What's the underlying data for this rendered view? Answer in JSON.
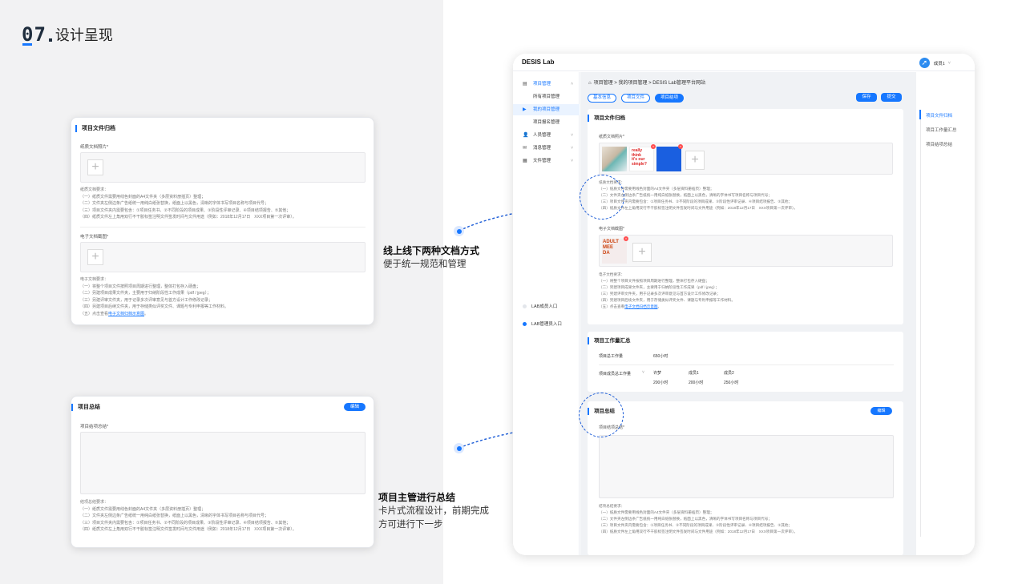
{
  "header": {
    "number": "07",
    "title": "设计呈现"
  },
  "left_card1": {
    "title": "项目文件归档",
    "paper_label": "纸质文档照片*",
    "paper_req_title": "纸质文档要求：",
    "paper_req": [
      "（一）纸质文件需要用线色封面的A4文件夹（多层资料册插页）整理；",
      "（二）文件夹左侧边条广告纸统一用纯白纸张替换，纸面上以黑色，清晰的字体书写项目名称与项目代号；",
      "（三）项目文件夹内需要包含：①项目任务书、②不同阶段的项目成果、③阶段性评审记录、④项目结项报告、⑤其他；",
      "（四）纸质文件左上角用双行不干胶标签注明文件签发时间与文件用途（例如：2018年12月17日　XXX项目第一次评审）。"
    ],
    "elec_label": "电子文档截图*",
    "elec_req_title": "电子文档要求：",
    "elec_req": [
      "（一）将整个项目文件按照项目周期进行整理，整体打包存入硬盘；",
      "（二）另建项目成果文件夹，主要用于归纳阶段性工作成果（pdf / jpeg）；",
      "（三）另建评审文件夹，用于记录多次评审意见与首方设计工作修改记录；",
      "（四）另建项目后续文件夹，用于存储类似评奖文件、课题与专利申报等工作材料。"
    ],
    "elec_req_last": "（五）点击查看",
    "elec_req_link": "电子文档归档示意图",
    "elec_req_end": "。"
  },
  "left_card2": {
    "title": "项目总结",
    "edit": "编辑",
    "summary_label": "项目结项总结*",
    "req_title": "结项总结要求：",
    "req": [
      "（一）纸质文件需要用线色封面的A4文件夹（多层资料册插页）整理；",
      "（二）文件夹左侧边条广告纸统一用纯白纸张替换，纸面上以黑色，清晰的字体书写项目名称与项目代号；",
      "（三）项目文件夹内需要包含：①项目任务书、②不同阶段的项目成果、③阶段性评审记录、④项目结项报告、⑤其他；",
      "（四）纸质文件左上角用双行不干胶标签注明文件签发时间与文件用途（例如：2018年12月17日　XXX项目第一次评审）。"
    ]
  },
  "annotations": [
    {
      "heading": "线上线下两种文档方式",
      "sub": [
        "便于统一规范和管理"
      ]
    },
    {
      "heading": "项目主管进行总结",
      "sub": [
        "卡片式流程设计，前期完成",
        "方可进行下一步"
      ]
    }
  ],
  "app": {
    "logo": "DESIS Lab",
    "user": "成员1",
    "nav": [
      {
        "label": "项目管理",
        "icon": "▤",
        "chevron": "˄"
      },
      {
        "label": "所有项目管理"
      },
      {
        "label": "我的项目管理",
        "icon": "▶"
      },
      {
        "label": "项目报名管理"
      },
      {
        "label": "人员管理",
        "icon": "👤",
        "chevron": "˅"
      },
      {
        "label": "消息管理",
        "icon": "✉",
        "chevron": "˅"
      },
      {
        "label": "文件管理",
        "icon": "▦",
        "chevron": "˅"
      }
    ],
    "entries": [
      "LAB成员入口",
      "LAB管理员入口"
    ],
    "breadcrumb": "项目管理 > 我的项目管理 > DESIS Lab管理平台网站",
    "tabs": [
      "基本信息",
      "项目文件",
      "项目结项"
    ],
    "save": "保存",
    "submit": "提交",
    "right_nav": [
      "项目文件归档",
      "项目工作量汇总",
      "项目结项总结"
    ],
    "archive": {
      "title": "项目文件归档",
      "paper_label": "纸质文档照片*",
      "thumb_text": [
        "really\nthink\nit's our\nsimple?"
      ],
      "req_title": "纸质文档要求：",
      "req": [
        "（一）纸质文件需要用线色封面的A4文件夹（多层资料册插页）整理；",
        "（二）文件夹左侧边条广告纸统一用纯白纸张替换，纸面上以黑色，清晰的字体书写项目名称与项目代号；",
        "（三）项目文件夹内需要包含：①项目任务书、②不同阶段的项目成果、③阶段性评审记录、④项目结项报告、⑤其他；",
        "（四）纸质文件左上角用双行不干胶标签注明文件签发时间与文件用途（例如：2018年12月17日　XXX项目第一次评审）。"
      ],
      "elec_label": "电子文档截图*",
      "elec_thumb": "ADULT\nMEE\nDA",
      "elec_req_title": "电子文档要求：",
      "elec_req": [
        "（一）将整个项目文件按照项目周期进行整理，整体打包存入硬盘；",
        "（二）另建项目成果文件夹，主要用于归纳阶段性工作成果（pdf / jpeg）；",
        "（三）另建评审文件夹，用于记录多次评审意见与首方设计工作修改记录；",
        "（四）另建项目后续文件夹，用于存储类似评奖文件、课题与专利申报等工作材料。"
      ],
      "elec_req_last": "（五）点击查看",
      "elec_req_link": "电子文档归档示意图",
      "elec_req_end": "。"
    },
    "workload": {
      "title": "项目工作量汇总",
      "total_label": "项目总工作量",
      "total_value": "650小时",
      "member_label": "项目成员总工作量",
      "members": [
        {
          "name": "许梦",
          "hours": "200小时"
        },
        {
          "name": "成员1",
          "hours": "200小时"
        },
        {
          "name": "成员2",
          "hours": "250小时"
        }
      ]
    },
    "summary": {
      "title": "项目总结",
      "edit": "编辑",
      "label": "项目结项总结*",
      "req_title": "结项总结要求：",
      "req": [
        "（一）纸质文件需要用线色封面的A4文件夹（多层资料册插页）整理；",
        "（二）文件夹左侧边条广告纸统一用纯白纸张替换，纸面上以黑色，清晰的字体书写项目名称与项目代号；",
        "（三）项目文件夹内需要包含：①项目任务书、②不同阶段的项目成果、③阶段性评审记录、④项目结项报告、⑤其他；",
        "（四）纸质文件左上角用双行不干胶标签注明文件签发时间与文件用途（例如：2018年12月17日　XXX项目第一次评审）。"
      ]
    }
  },
  "colors": {
    "accent": "#1677ff",
    "bg_left": "#f2f2f3",
    "panel_bg": "#f0f2f5"
  }
}
